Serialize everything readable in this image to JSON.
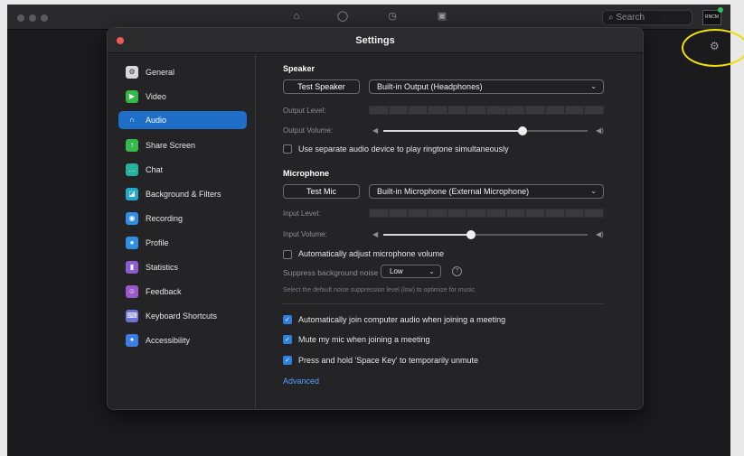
{
  "topbar": {
    "icons": [
      "home-icon",
      "chat-icon",
      "clock-icon",
      "contacts-icon"
    ],
    "search_placeholder": "Search",
    "avatar_text": "RNCM"
  },
  "settings": {
    "title": "Settings",
    "sidebar": {
      "items": [
        {
          "label": "General",
          "icon": "gear-icon",
          "color": "#d9d9d9"
        },
        {
          "label": "Video",
          "icon": "video-icon",
          "color": "#36b94a"
        },
        {
          "label": "Audio",
          "icon": "headphones-icon",
          "color": "#1f6fc8"
        },
        {
          "label": "Share Screen",
          "icon": "share-screen-icon",
          "color": "#36b94a"
        },
        {
          "label": "Chat",
          "icon": "chat-icon",
          "color": "#27b29a"
        },
        {
          "label": "Background & Filters",
          "icon": "background-icon",
          "color": "#24a8c9"
        },
        {
          "label": "Recording",
          "icon": "recording-icon",
          "color": "#2f90e3"
        },
        {
          "label": "Profile",
          "icon": "profile-icon",
          "color": "#2f90e3"
        },
        {
          "label": "Statistics",
          "icon": "statistics-icon",
          "color": "#8a5ccf"
        },
        {
          "label": "Feedback",
          "icon": "feedback-icon",
          "color": "#9b59c9"
        },
        {
          "label": "Keyboard Shortcuts",
          "icon": "keyboard-icon",
          "color": "#6f6fd6"
        },
        {
          "label": "Accessibility",
          "icon": "accessibility-icon",
          "color": "#3b7fe6"
        }
      ]
    },
    "speaker": {
      "title": "Speaker",
      "test_button": "Test Speaker",
      "device": "Built-in Output (Headphones)",
      "output_level_label": "Output Level:",
      "output_volume_label": "Output Volume:",
      "volume": 0.68,
      "separate_device_label": "Use separate audio device to play ringtone simultaneously",
      "separate_device_checked": false
    },
    "microphone": {
      "title": "Microphone",
      "test_button": "Test Mic",
      "device": "Built-in Microphone (External Microphone)",
      "input_level_label": "Input Level:",
      "input_volume_label": "Input Volume:",
      "volume": 0.43,
      "auto_adjust_label": "Automatically adjust microphone volume",
      "auto_adjust_checked": false,
      "suppress_label": "Suppress background noise",
      "suppress_value": "Low",
      "suppress_note": "Select the default noise suppression level (low) to optimize for music"
    },
    "options": [
      {
        "label": "Automatically join computer audio when joining a meeting",
        "checked": true
      },
      {
        "label": "Mute my mic when joining a meeting",
        "checked": true
      },
      {
        "label": "Press and hold 'Space Key' to temporarily unmute",
        "checked": true
      }
    ],
    "advanced_label": "Advanced"
  },
  "colors": {
    "accent": "#1f6fc8",
    "checkbox": "#2f7fdc",
    "link": "#4ea1ff",
    "highlight_ring": "#f2e000"
  }
}
